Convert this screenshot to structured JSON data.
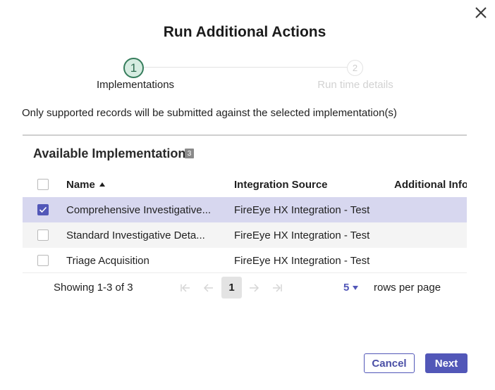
{
  "dialog": {
    "title": "Run Additional Actions",
    "close_icon": "close-icon"
  },
  "stepper": {
    "steps": [
      {
        "number": "1",
        "label": "Implementations",
        "state": "active"
      },
      {
        "number": "2",
        "label": "Run time details",
        "state": "inactive"
      }
    ]
  },
  "notice": "Only supported records will be submitted against the selected implementation(s)",
  "section": {
    "title": "Available Implementations",
    "count": "3"
  },
  "table": {
    "headers": {
      "name": "Name",
      "source": "Integration Source",
      "additional": "Additional Infori"
    },
    "rows": [
      {
        "name": "Comprehensive Investigative...",
        "source": "FireEye HX Integration - Test",
        "additional": "",
        "selected": true
      },
      {
        "name": "Standard Investigative Deta...",
        "source": "FireEye HX Integration - Test",
        "additional": "",
        "selected": false
      },
      {
        "name": "Triage Acquisition",
        "source": "FireEye HX Integration - Test",
        "additional": "",
        "selected": false
      }
    ]
  },
  "pager": {
    "showing": "Showing 1-3 of 3",
    "page": "1",
    "rows_per_page_value": "5",
    "rows_per_page_label": "rows per page"
  },
  "actions": {
    "cancel_label": "Cancel",
    "next_label": "Next"
  },
  "colors": {
    "accent": "#5257b8",
    "step_active": "#367d5c",
    "selected_row": "#d7d7ef"
  }
}
